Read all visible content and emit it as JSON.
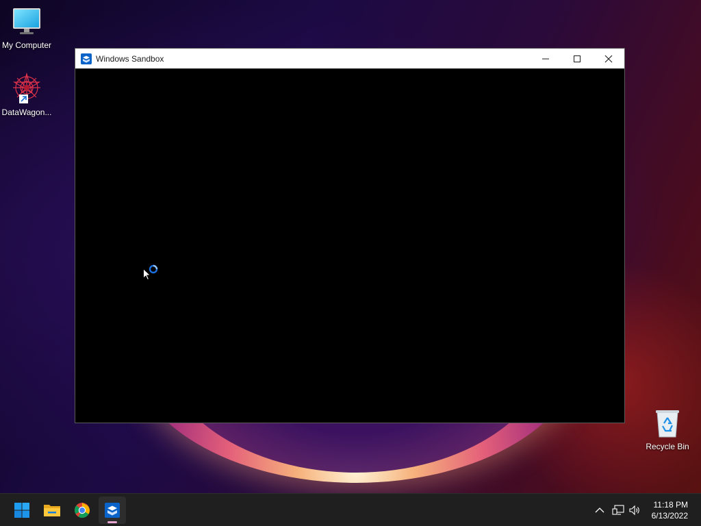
{
  "desktop": {
    "icons": [
      {
        "label": "My Computer",
        "icon": "monitor-icon"
      },
      {
        "label": "DataWagon...",
        "icon": "datawagon-shortcut-icon"
      },
      {
        "label": "Recycle Bin",
        "icon": "recycle-bin-icon"
      }
    ]
  },
  "window": {
    "title": "Windows Sandbox",
    "icon": "sandbox-icon",
    "buttons": {
      "minimize": "minimize-icon",
      "maximize": "maximize-icon",
      "close": "close-icon"
    },
    "state": "loading"
  },
  "taskbar": {
    "apps": [
      {
        "name": "Start",
        "icon": "windows-start-icon"
      },
      {
        "name": "File Explorer",
        "icon": "folder-icon"
      },
      {
        "name": "Google Chrome",
        "icon": "chrome-icon"
      },
      {
        "name": "Windows Sandbox",
        "icon": "sandbox-icon",
        "active": true
      }
    ],
    "tray": {
      "icons": [
        "chevron-up-icon",
        "network-icon",
        "speaker-icon"
      ]
    },
    "clock": {
      "time": "11:18 PM",
      "date": "6/13/2022"
    }
  },
  "colors": {
    "taskbar_bg": "#1f1f1f",
    "accent": "#0078d4",
    "active_indicator": "#e7a6cf"
  }
}
